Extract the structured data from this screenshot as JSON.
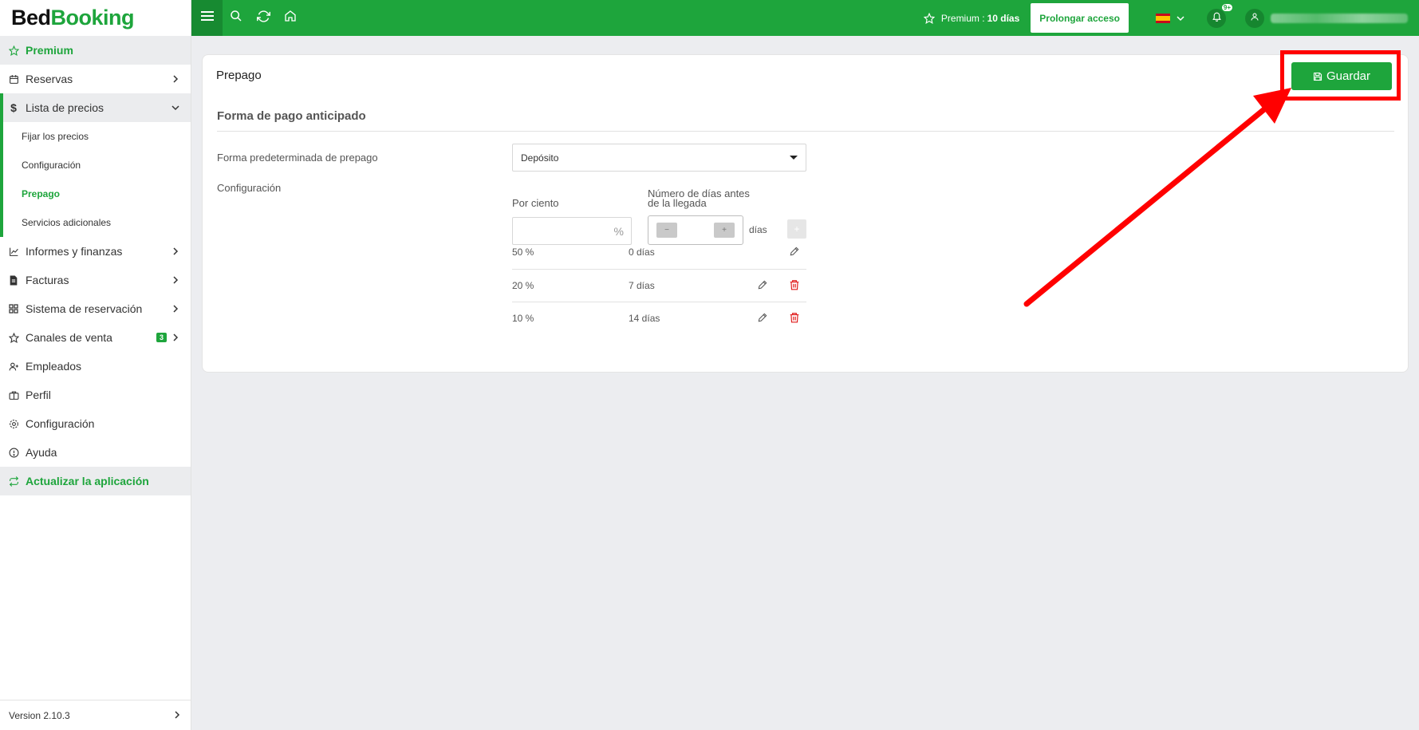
{
  "brand": {
    "part1": "Bed",
    "part2": "Booking",
    "accent": "#1ea53c"
  },
  "sidebar": {
    "premium": "Premium",
    "items": [
      {
        "label": "Reservas"
      },
      {
        "label": "Lista de precios"
      },
      {
        "label": "Informes y finanzas"
      },
      {
        "label": "Facturas"
      },
      {
        "label": "Sistema de reservación"
      },
      {
        "label": "Canales de venta",
        "badge": "3"
      },
      {
        "label": "Empleados"
      },
      {
        "label": "Perfil"
      },
      {
        "label": "Configuración"
      },
      {
        "label": "Ayuda"
      }
    ],
    "subitems": [
      {
        "label": "Fijar los precios"
      },
      {
        "label": "Configuración"
      },
      {
        "label": "Prepago"
      },
      {
        "label": "Servicios adicionales"
      }
    ],
    "update": "Actualizar la aplicación",
    "version": "Version 2.10.3"
  },
  "topbar": {
    "premium_label": "Premium :",
    "premium_days": "10 días",
    "prolongar": "Prolongar acceso",
    "notif_badge": "9+"
  },
  "page": {
    "title": "Prepago",
    "save": "Guardar",
    "section": "Forma de pago anticipado",
    "default_label": "Forma predeterminada de prepago",
    "default_value": "Depósito",
    "config_label": "Configuración",
    "col_percent": "Por ciento",
    "col_days_line1": "Número de días antes",
    "col_days_line2": "de la llegada",
    "percent_symbol": "%",
    "minus": "−",
    "plus": "+",
    "days_unit": "días",
    "rows": [
      {
        "percent": "50 %",
        "days": "0 días"
      },
      {
        "percent": "20 %",
        "days": "7 días"
      },
      {
        "percent": "10 %",
        "days": "14 días"
      }
    ]
  },
  "colors": {
    "delete": "#e01b1b",
    "annotation": "#ff0000"
  }
}
